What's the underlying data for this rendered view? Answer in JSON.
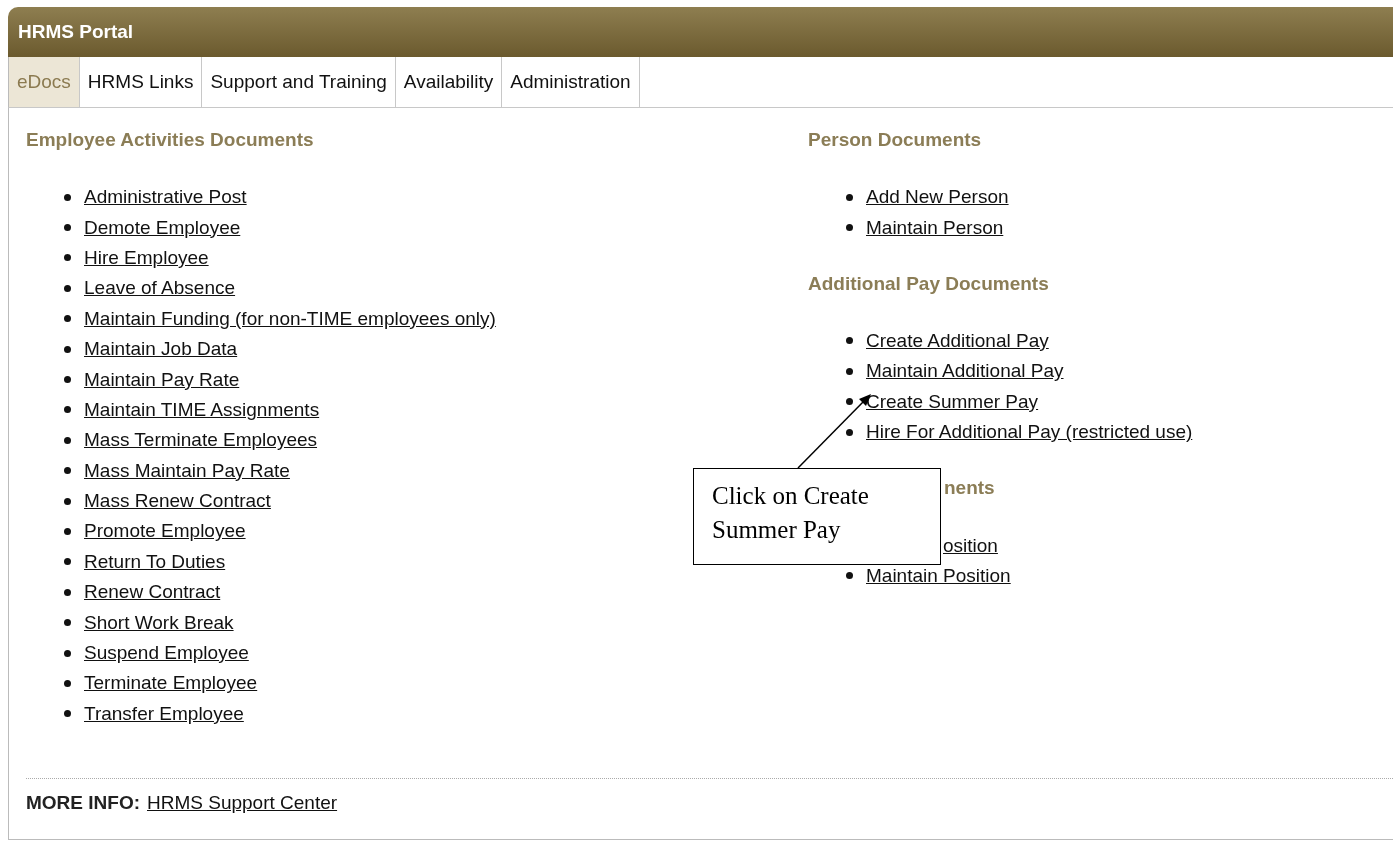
{
  "window": {
    "title": "HRMS Portal"
  },
  "tabs": [
    {
      "label": "eDocs",
      "selected": true
    },
    {
      "label": "HRMS Links",
      "selected": false
    },
    {
      "label": "Support and Training",
      "selected": false
    },
    {
      "label": "Availability",
      "selected": false
    },
    {
      "label": "Administration",
      "selected": false
    }
  ],
  "left_sections": [
    {
      "heading": "Employee Activities Documents",
      "items": [
        {
          "label": "Administrative Post"
        },
        {
          "label": "Demote Employee"
        },
        {
          "label": "Hire Employee"
        },
        {
          "label": "Leave of Absence"
        },
        {
          "label": "Maintain Funding (for non-TIME employees only)"
        },
        {
          "label": "Maintain Job Data"
        },
        {
          "label": "Maintain Pay Rate"
        },
        {
          "label": "Maintain TIME Assignments"
        },
        {
          "label": "Mass Terminate Employees"
        },
        {
          "label": "Mass Maintain Pay Rate"
        },
        {
          "label": "Mass Renew Contract"
        },
        {
          "label": "Promote Employee"
        },
        {
          "label": "Return To Duties"
        },
        {
          "label": "Renew Contract"
        },
        {
          "label": "Short Work Break"
        },
        {
          "label": "Suspend Employee"
        },
        {
          "label": "Terminate Employee"
        },
        {
          "label": "Transfer Employee"
        }
      ]
    }
  ],
  "right_sections": [
    {
      "heading": "Person Documents",
      "kind": "full",
      "items": [
        {
          "label": "Add New Person",
          "kind": "full"
        },
        {
          "label": "Maintain Person",
          "kind": "full"
        }
      ]
    },
    {
      "heading": "Additional Pay Documents",
      "kind": "full",
      "items": [
        {
          "label": "Create Additional Pay",
          "kind": "full"
        },
        {
          "label": "Maintain Additional Pay",
          "kind": "full"
        },
        {
          "label": "Create Summer Pay",
          "kind": "full"
        },
        {
          "label": "Hire For Additional Pay (restricted use)",
          "kind": "full"
        }
      ]
    },
    {
      "heading": "nents",
      "kind": "cut",
      "items": [
        {
          "label": "osition",
          "kind": "cut"
        },
        {
          "label": "Maintain Position",
          "kind": "full"
        }
      ]
    }
  ],
  "callout": {
    "text": "Click on Create Summer Pay"
  },
  "footer": {
    "label": "MORE INFO:",
    "link": "HRMS Support Center"
  }
}
